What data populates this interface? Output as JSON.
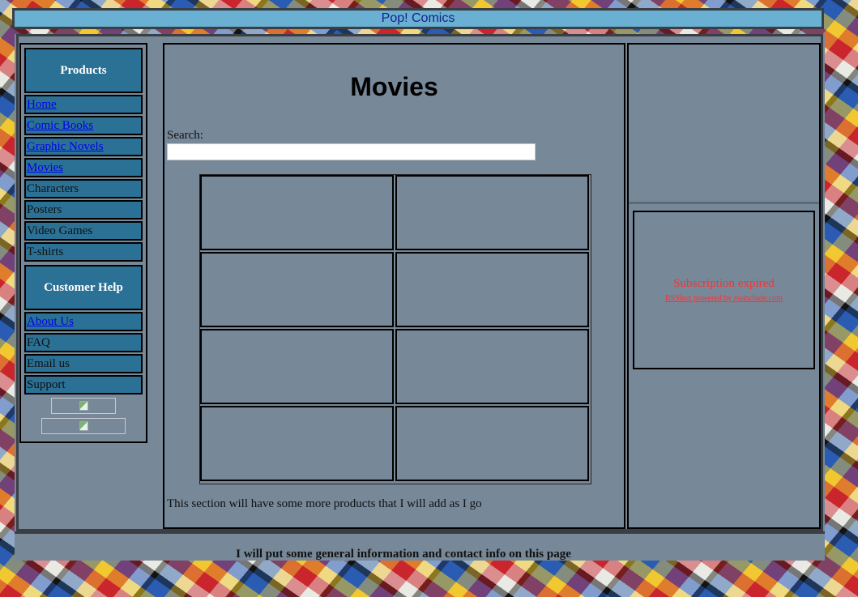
{
  "header": {
    "title": "Pop! Comics"
  },
  "sidebar": {
    "products_heading": "Products",
    "product_links": [
      {
        "label": "Home",
        "link": true
      },
      {
        "label": "Comic Books",
        "link": true
      },
      {
        "label": "Graphic Novels",
        "link": true
      },
      {
        "label": "Movies",
        "link": true
      },
      {
        "label": "Characters",
        "link": false
      },
      {
        "label": "Posters",
        "link": false
      },
      {
        "label": "Video Games",
        "link": false
      },
      {
        "label": "T-shirts",
        "link": false
      }
    ],
    "help_heading": "Customer Help",
    "help_links": [
      {
        "label": "About Us",
        "link": true
      },
      {
        "label": "FAQ",
        "link": false
      },
      {
        "label": "Email us",
        "link": false
      },
      {
        "label": "Support",
        "link": false
      }
    ]
  },
  "main": {
    "title": "Movies",
    "search_label": "Search:",
    "search_value": "",
    "grid_rows": 4,
    "grid_cols": 2,
    "note": "This section will have some more products that I will add as I go"
  },
  "right": {
    "rss_message": "Subscription expired",
    "rss_credit": "RSSbox powered by rssinclude.com"
  },
  "footer": {
    "text": "I will put some general information and contact info on this page"
  },
  "colors": {
    "header_bg": "#6ab0d2",
    "panel_bg": "#778899",
    "sidebar_item_bg": "#2b7195",
    "link": "#0000ee",
    "rss_text": "#ff3030"
  }
}
